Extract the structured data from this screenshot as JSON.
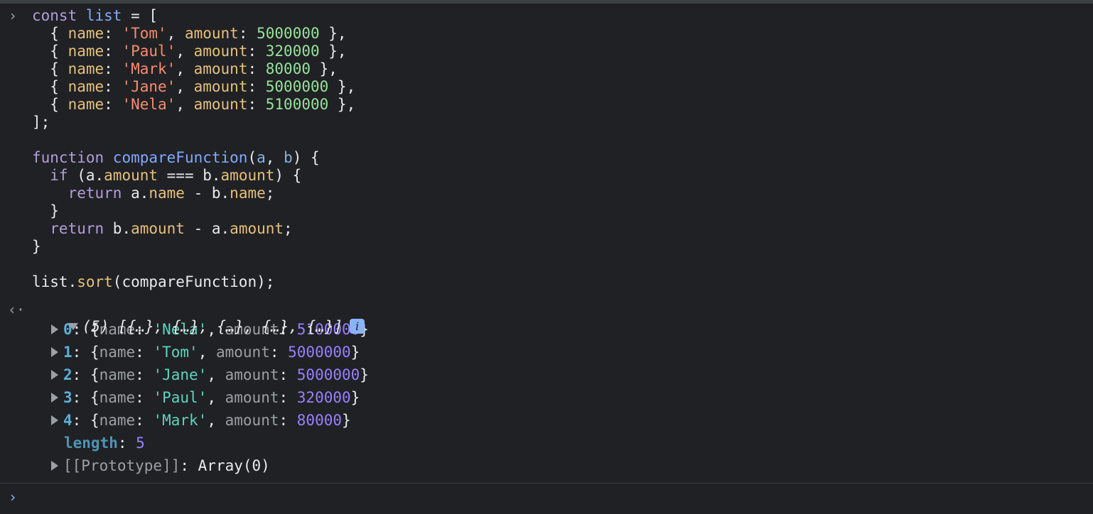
{
  "input": {
    "prompt_glyph": "›",
    "lines": [
      [
        {
          "t": "const ",
          "c": "kw"
        },
        {
          "t": "list",
          "c": "def"
        },
        {
          "t": " = [",
          "c": "plain"
        }
      ],
      [
        {
          "t": "  { ",
          "c": "plain"
        },
        {
          "t": "name",
          "c": "prop"
        },
        {
          "t": ": ",
          "c": "plain"
        },
        {
          "t": "'Tom'",
          "c": "str"
        },
        {
          "t": ", ",
          "c": "plain"
        },
        {
          "t": "amount",
          "c": "prop"
        },
        {
          "t": ": ",
          "c": "plain"
        },
        {
          "t": "5000000",
          "c": "num"
        },
        {
          "t": " },",
          "c": "plain"
        }
      ],
      [
        {
          "t": "  { ",
          "c": "plain"
        },
        {
          "t": "name",
          "c": "prop"
        },
        {
          "t": ": ",
          "c": "plain"
        },
        {
          "t": "'Paul'",
          "c": "str"
        },
        {
          "t": ", ",
          "c": "plain"
        },
        {
          "t": "amount",
          "c": "prop"
        },
        {
          "t": ": ",
          "c": "plain"
        },
        {
          "t": "320000",
          "c": "num"
        },
        {
          "t": " },",
          "c": "plain"
        }
      ],
      [
        {
          "t": "  { ",
          "c": "plain"
        },
        {
          "t": "name",
          "c": "prop"
        },
        {
          "t": ": ",
          "c": "plain"
        },
        {
          "t": "'Mark'",
          "c": "str"
        },
        {
          "t": ", ",
          "c": "plain"
        },
        {
          "t": "amount",
          "c": "prop"
        },
        {
          "t": ": ",
          "c": "plain"
        },
        {
          "t": "80000",
          "c": "num"
        },
        {
          "t": " },",
          "c": "plain"
        }
      ],
      [
        {
          "t": "  { ",
          "c": "plain"
        },
        {
          "t": "name",
          "c": "prop"
        },
        {
          "t": ": ",
          "c": "plain"
        },
        {
          "t": "'Jane'",
          "c": "str"
        },
        {
          "t": ", ",
          "c": "plain"
        },
        {
          "t": "amount",
          "c": "prop"
        },
        {
          "t": ": ",
          "c": "plain"
        },
        {
          "t": "5000000",
          "c": "num"
        },
        {
          "t": " },",
          "c": "plain"
        }
      ],
      [
        {
          "t": "  { ",
          "c": "plain"
        },
        {
          "t": "name",
          "c": "prop"
        },
        {
          "t": ": ",
          "c": "plain"
        },
        {
          "t": "'Nela'",
          "c": "str"
        },
        {
          "t": ", ",
          "c": "plain"
        },
        {
          "t": "amount",
          "c": "prop"
        },
        {
          "t": ": ",
          "c": "plain"
        },
        {
          "t": "5100000",
          "c": "num"
        },
        {
          "t": " },",
          "c": "plain"
        }
      ],
      [
        {
          "t": "];",
          "c": "plain"
        }
      ],
      [],
      [
        {
          "t": "function ",
          "c": "kw"
        },
        {
          "t": "compareFunction",
          "c": "def"
        },
        {
          "t": "(",
          "c": "plain"
        },
        {
          "t": "a",
          "c": "param"
        },
        {
          "t": ", ",
          "c": "plain"
        },
        {
          "t": "b",
          "c": "param"
        },
        {
          "t": ") {",
          "c": "plain"
        }
      ],
      [
        {
          "t": "  if ",
          "c": "kw"
        },
        {
          "t": "(a.",
          "c": "plain"
        },
        {
          "t": "amount",
          "c": "prop"
        },
        {
          "t": " === b.",
          "c": "plain"
        },
        {
          "t": "amount",
          "c": "prop"
        },
        {
          "t": ") {",
          "c": "plain"
        }
      ],
      [
        {
          "t": "    return ",
          "c": "kw"
        },
        {
          "t": "a.",
          "c": "plain"
        },
        {
          "t": "name",
          "c": "prop"
        },
        {
          "t": " - b.",
          "c": "plain"
        },
        {
          "t": "name",
          "c": "prop"
        },
        {
          "t": ";",
          "c": "plain"
        }
      ],
      [
        {
          "t": "  }",
          "c": "plain"
        }
      ],
      [
        {
          "t": "  return ",
          "c": "kw"
        },
        {
          "t": "b.",
          "c": "plain"
        },
        {
          "t": "amount",
          "c": "prop"
        },
        {
          "t": " - a.",
          "c": "plain"
        },
        {
          "t": "amount",
          "c": "prop"
        },
        {
          "t": ";",
          "c": "plain"
        }
      ],
      [
        {
          "t": "}",
          "c": "plain"
        }
      ],
      [],
      [
        {
          "t": "list.",
          "c": "plain"
        },
        {
          "t": "sort",
          "c": "prop"
        },
        {
          "t": "(compareFunction);",
          "c": "plain"
        }
      ]
    ]
  },
  "output": {
    "return_glyph": "‹·",
    "summary": "(5) [{…}, {…}, {…}, {…}, {…}]",
    "info_label": "i",
    "items": [
      {
        "index": "0",
        "name": "'Nela'",
        "amount": "5100000"
      },
      {
        "index": "1",
        "name": "'Tom'",
        "amount": "5000000"
      },
      {
        "index": "2",
        "name": "'Jane'",
        "amount": "5000000"
      },
      {
        "index": "3",
        "name": "'Paul'",
        "amount": "320000"
      },
      {
        "index": "4",
        "name": "'Mark'",
        "amount": "80000"
      }
    ],
    "length_key": "length",
    "length_value": "5",
    "prototype_key": "[[Prototype]]",
    "prototype_value": "Array(0)"
  },
  "console_prompt_glyph": "›",
  "colors": {
    "background": "#202124",
    "string_value": "#5cd4c0",
    "number_value": "#9980ff",
    "index": "#5db0d7"
  }
}
